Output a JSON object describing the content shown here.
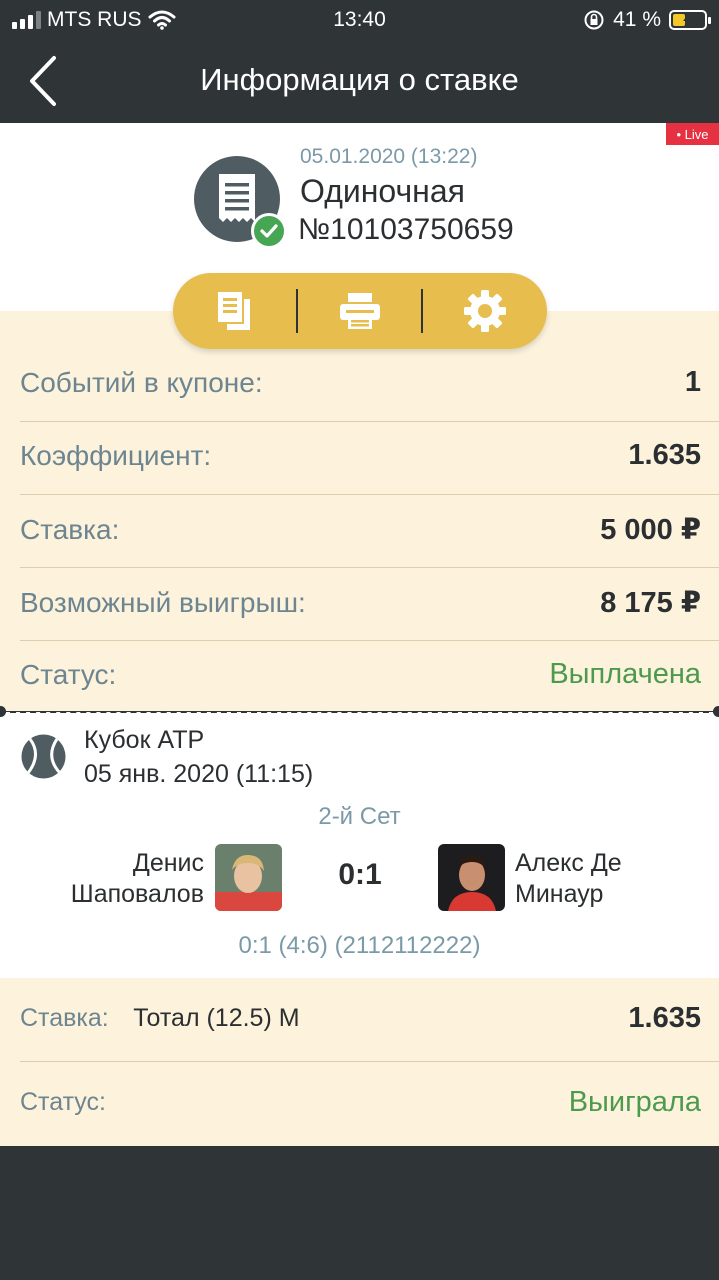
{
  "status_bar": {
    "carrier": "MTS RUS",
    "time": "13:40",
    "battery_text": "41 %",
    "battery_level": 0.41
  },
  "nav": {
    "title": "Информация о ставке",
    "back_icon": "chevron-left-icon"
  },
  "header": {
    "live_badge": "• Live",
    "date": "05.01.2020 (13:22)",
    "bet_type": "Одиночная",
    "bet_number": "№10103750659",
    "icon": "receipt-icon",
    "status_icon": "check-icon",
    "status_color": "#46a653"
  },
  "actions": [
    {
      "icon": "copy-document-icon"
    },
    {
      "icon": "printer-icon"
    },
    {
      "icon": "gear-icon"
    }
  ],
  "summary": {
    "rows": [
      {
        "label": "Событий в купоне:",
        "value": "1"
      },
      {
        "label": "Коэффициент:",
        "value": "1.635"
      },
      {
        "label": "Ставка:",
        "value": "5 000 ₽"
      },
      {
        "label": "Возможный выигрыш:",
        "value": "8 175 ₽"
      },
      {
        "label": "Статус:",
        "value": "Выплачена"
      }
    ]
  },
  "event": {
    "sport_icon": "tennis-ball-icon",
    "tournament": "Кубок ATP",
    "date": "05 янв. 2020 (11:15)",
    "set": "2-й Сет",
    "player1": {
      "first": "Денис",
      "last": "Шаповалов"
    },
    "player2": {
      "first": "Алекс Де",
      "last": "Минаур"
    },
    "score": "0:1",
    "score_detail": "0:1 (4:6) (2112112222)"
  },
  "bet": {
    "stake_label": "Ставка:",
    "market": "Тотал (12.5) М",
    "odds": "1.635",
    "status_label": "Статус:",
    "status_value": "Выиграла"
  },
  "colors": {
    "dark": "#2f3437",
    "cream": "#fdf3dc",
    "gold": "#e7bd4e",
    "green": "#4c9a4e",
    "live_red": "#e53141"
  }
}
